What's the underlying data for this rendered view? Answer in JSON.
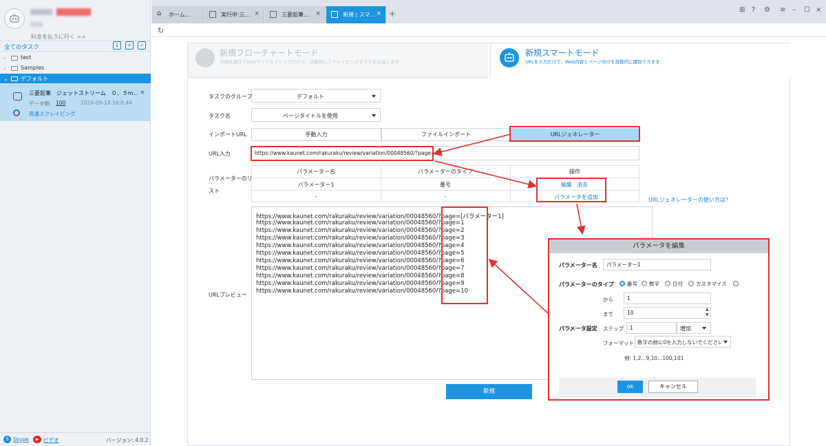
{
  "sidebar": {
    "pay_link": "料金を払うに行く >>",
    "tasks_title": "全てのタスク",
    "tree": [
      {
        "label": "test"
      },
      {
        "label": "Samples"
      },
      {
        "label": "デフォルト"
      }
    ],
    "task": {
      "name": "三菱鉛筆　ジェットストリーム　０．５m...",
      "data_label": "データ数:",
      "data_count": "100",
      "date": "2024-09-18 16:8:44",
      "speed_label": "高速スクレイピング"
    },
    "footer": {
      "skype": "Skype",
      "video": "ビデオ",
      "version": "バージョン: 4.0.2"
    }
  },
  "tabs": [
    {
      "label": "ホーム...",
      "active": false
    },
    {
      "label": "実行中:三...",
      "active": false
    },
    {
      "label": "三菱鉛筆...",
      "active": false
    },
    {
      "label": "新規 | スマ...",
      "active": true
    }
  ],
  "modes": {
    "left": {
      "title": "新規フローチャートモード",
      "subtitle": "可視化操作でWebサイトをクリックだけで、自動的にスクレイピングタスクを生成します"
    },
    "right": {
      "title": "新規スマートモード",
      "subtitle": "URLを入力だけで、Web内容とページ分けを自動的に識別できます"
    }
  },
  "form": {
    "group_label": "タスクのグループ",
    "group_value": "デフォルト",
    "name_label": "タスク名",
    "name_value": "ページタイトルを使用",
    "import_label": "インポートURL",
    "segments": [
      "手動入力",
      "ファイルインポート",
      "URLジェネレーター"
    ],
    "url_label": "URL入力",
    "url_value": "https://www.kaunet.com/rakuraku/review/variation/00048560/?page=",
    "param_list_label_1": "パラメーターのリ",
    "param_list_label_2": "スト",
    "param_table": {
      "headers": [
        "パラメーター名",
        "パラメーターのタイプ",
        "操作"
      ],
      "row": {
        "name": "パラメーター1",
        "type": "番号",
        "edit": "編集",
        "delete": "消去"
      },
      "empty_name": "-",
      "empty_type": "-",
      "add": "パラメータを追加"
    },
    "help_link": "URLジェネレーターの使い方は?",
    "preview_label": "URLプレビュー",
    "preview_lines": [
      "https://www.kaunet.com/rakuraku/review/variation/00048560/?page=[パラメーター1]",
      "https://www.kaunet.com/rakuraku/review/variation/00048560/?page=1",
      "https://www.kaunet.com/rakuraku/review/variation/00048560/?page=2",
      "https://www.kaunet.com/rakuraku/review/variation/00048560/?page=3",
      "https://www.kaunet.com/rakuraku/review/variation/00048560/?page=4",
      "https://www.kaunet.com/rakuraku/review/variation/00048560/?page=5",
      "https://www.kaunet.com/rakuraku/review/variation/00048560/?page=6",
      "https://www.kaunet.com/rakuraku/review/variation/00048560/?page=7",
      "https://www.kaunet.com/rakuraku/review/variation/00048560/?page=8",
      "https://www.kaunet.com/rakuraku/review/variation/00048560/?page=9",
      "https://www.kaunet.com/rakuraku/review/variation/00048560/?page=10"
    ],
    "create_button": "新規"
  },
  "dialog": {
    "title": "パラメータを編集",
    "name_label": "パラメーター名",
    "name_value": "パラメーター1",
    "type_label": "パラメーターのタイプ",
    "types": [
      "番号",
      "数字",
      "日付",
      "カスタマイズ",
      ""
    ],
    "from_label": "から",
    "from_value": "1",
    "to_label": "まで",
    "to_value": "10",
    "setting_label": "パラメータ設定",
    "step_label": "ステップ",
    "step_value": "1",
    "step_mode": "増加",
    "format_label": "フォーマット",
    "format_value": "数字の前に0を入力しないでください",
    "example": "例: 1,2...9,10...100,101",
    "ok": "ok",
    "cancel": "キャンセル"
  },
  "colors": {
    "accent": "#1b95e0",
    "highlight": "#e0302f",
    "active_tab": "#1b95e0"
  }
}
